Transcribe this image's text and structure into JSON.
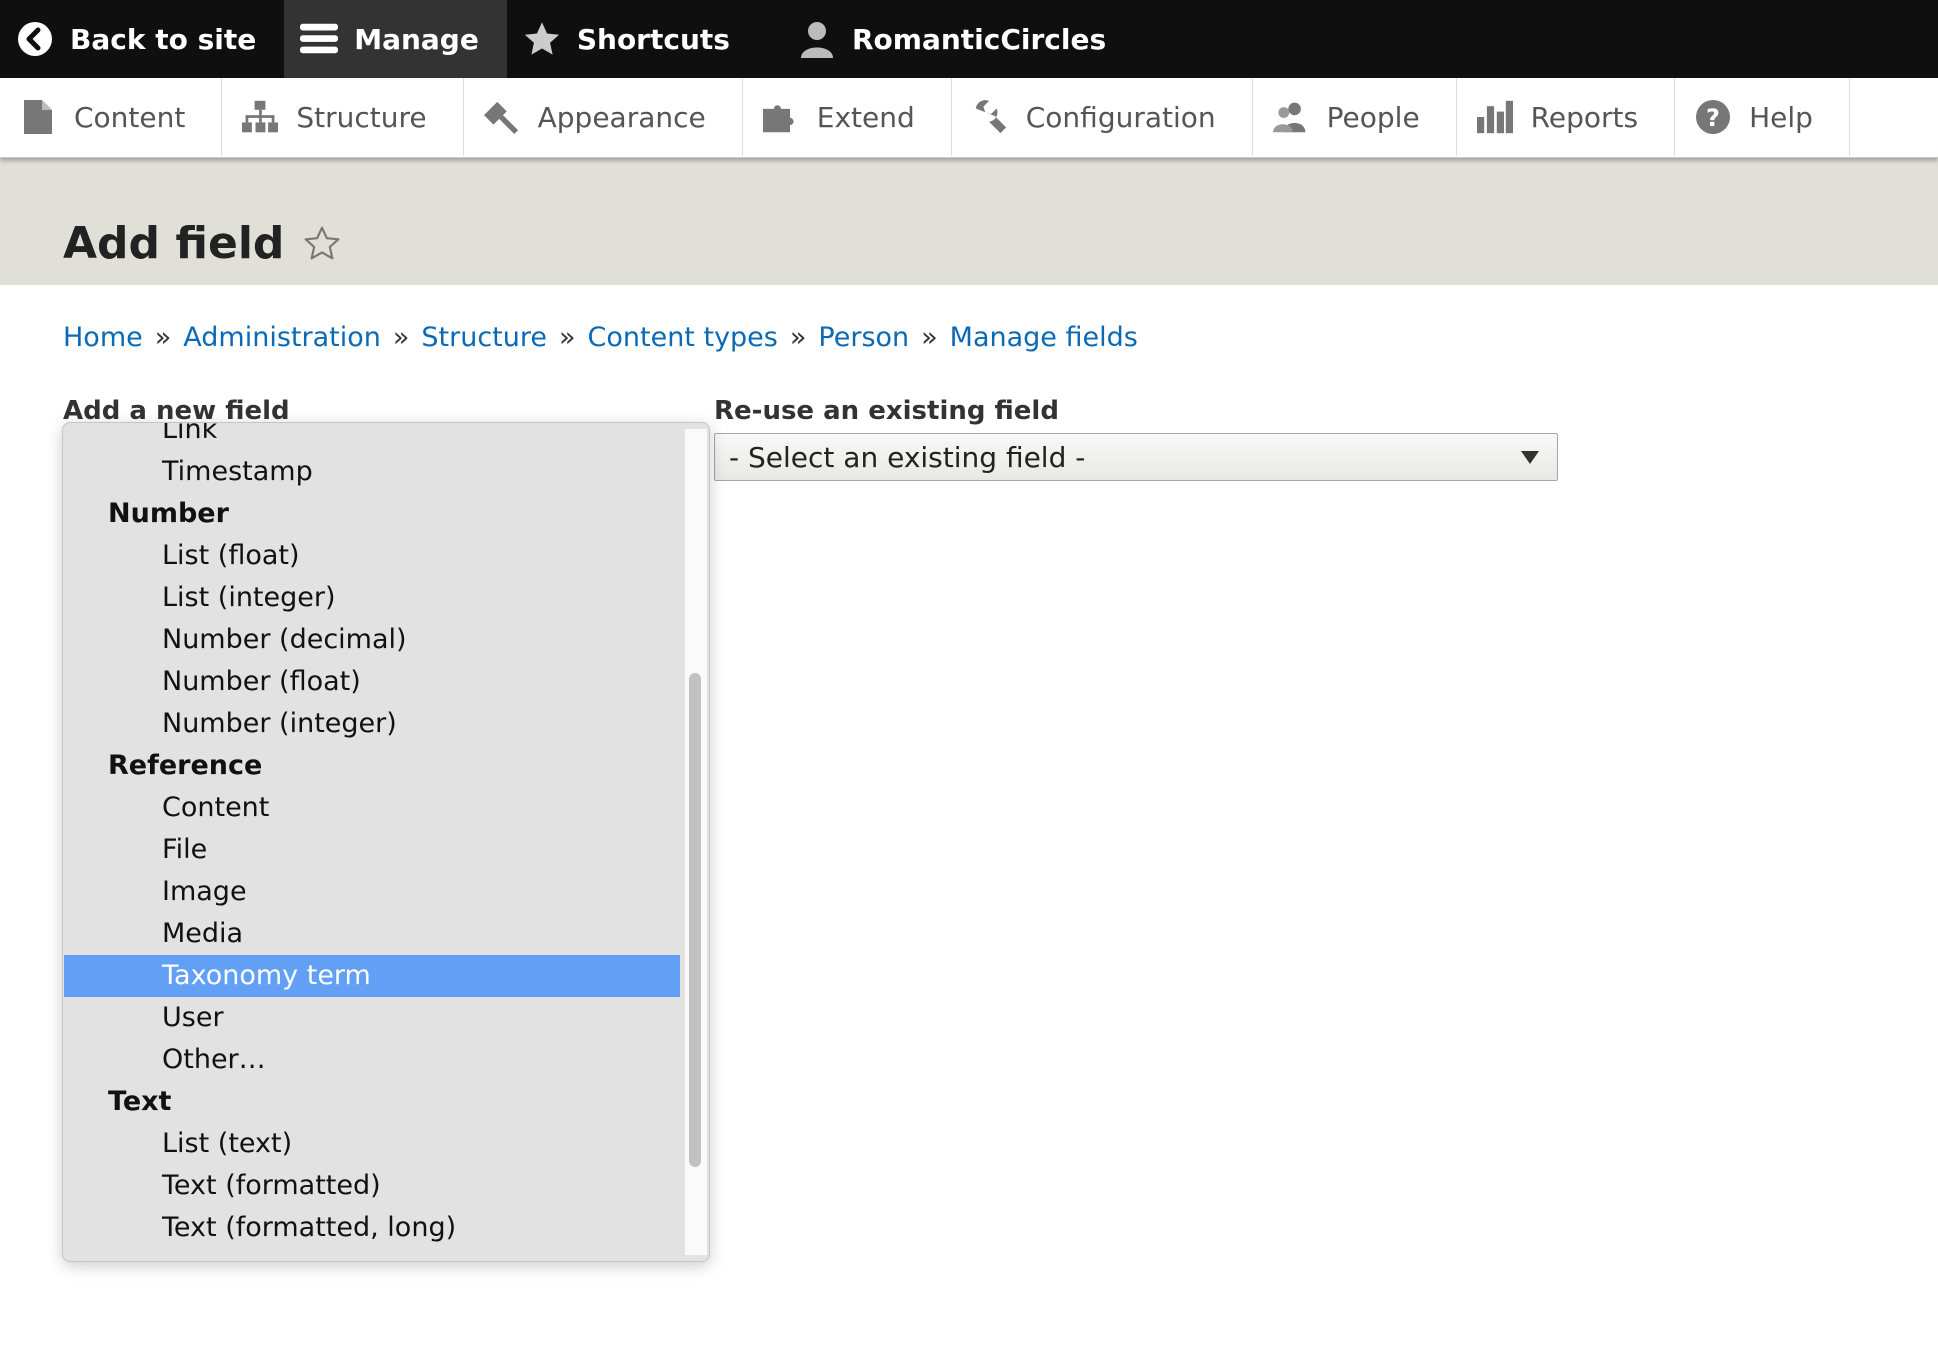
{
  "toolbar": {
    "items": [
      {
        "label": "Back to site",
        "icon": "back-arrow-icon"
      },
      {
        "label": "Manage",
        "icon": "hamburger-menu-icon"
      },
      {
        "label": "Shortcuts",
        "icon": "star-icon"
      },
      {
        "label": "RomanticCircles",
        "icon": "user-icon"
      }
    ]
  },
  "tray": {
    "items": [
      {
        "label": "Content",
        "icon": "document-icon"
      },
      {
        "label": "Structure",
        "icon": "sitemap-icon"
      },
      {
        "label": "Appearance",
        "icon": "paintbrush-icon"
      },
      {
        "label": "Extend",
        "icon": "puzzle-icon"
      },
      {
        "label": "Configuration",
        "icon": "wrench-icon"
      },
      {
        "label": "People",
        "icon": "people-icon"
      },
      {
        "label": "Reports",
        "icon": "bar-chart-icon"
      },
      {
        "label": "Help",
        "icon": "help-icon"
      }
    ]
  },
  "page": {
    "title": "Add field"
  },
  "breadcrumb": [
    "Home",
    "Administration",
    "Structure",
    "Content types",
    "Person",
    "Manage fields"
  ],
  "breadcrumb_separator": "»",
  "form": {
    "add_new_label": "Add a new field",
    "reuse_label": "Re-use an existing field",
    "reuse_select_value": "- Select an existing field -"
  },
  "dropdown": {
    "rows": [
      {
        "type": "option",
        "label": "Link"
      },
      {
        "type": "option",
        "label": "Timestamp"
      },
      {
        "type": "group",
        "label": "Number"
      },
      {
        "type": "option",
        "label": "List (float)"
      },
      {
        "type": "option",
        "label": "List (integer)"
      },
      {
        "type": "option",
        "label": "Number (decimal)"
      },
      {
        "type": "option",
        "label": "Number (float)"
      },
      {
        "type": "option",
        "label": "Number (integer)"
      },
      {
        "type": "group",
        "label": "Reference"
      },
      {
        "type": "option",
        "label": "Content"
      },
      {
        "type": "option",
        "label": "File"
      },
      {
        "type": "option",
        "label": "Image"
      },
      {
        "type": "option",
        "label": "Media"
      },
      {
        "type": "option",
        "label": "Taxonomy term",
        "selected": true
      },
      {
        "type": "option",
        "label": "User"
      },
      {
        "type": "option",
        "label": "Other…"
      },
      {
        "type": "group",
        "label": "Text"
      },
      {
        "type": "option",
        "label": "List (text)"
      },
      {
        "type": "option",
        "label": "Text (formatted)"
      },
      {
        "type": "option",
        "label": "Text (formatted, long)"
      }
    ],
    "selected_color": "#62a0f6"
  },
  "colors": {
    "toolbar_bg": "#0f0f0f",
    "header_bg": "#e0e0d8",
    "link": "#0a6ab6"
  }
}
